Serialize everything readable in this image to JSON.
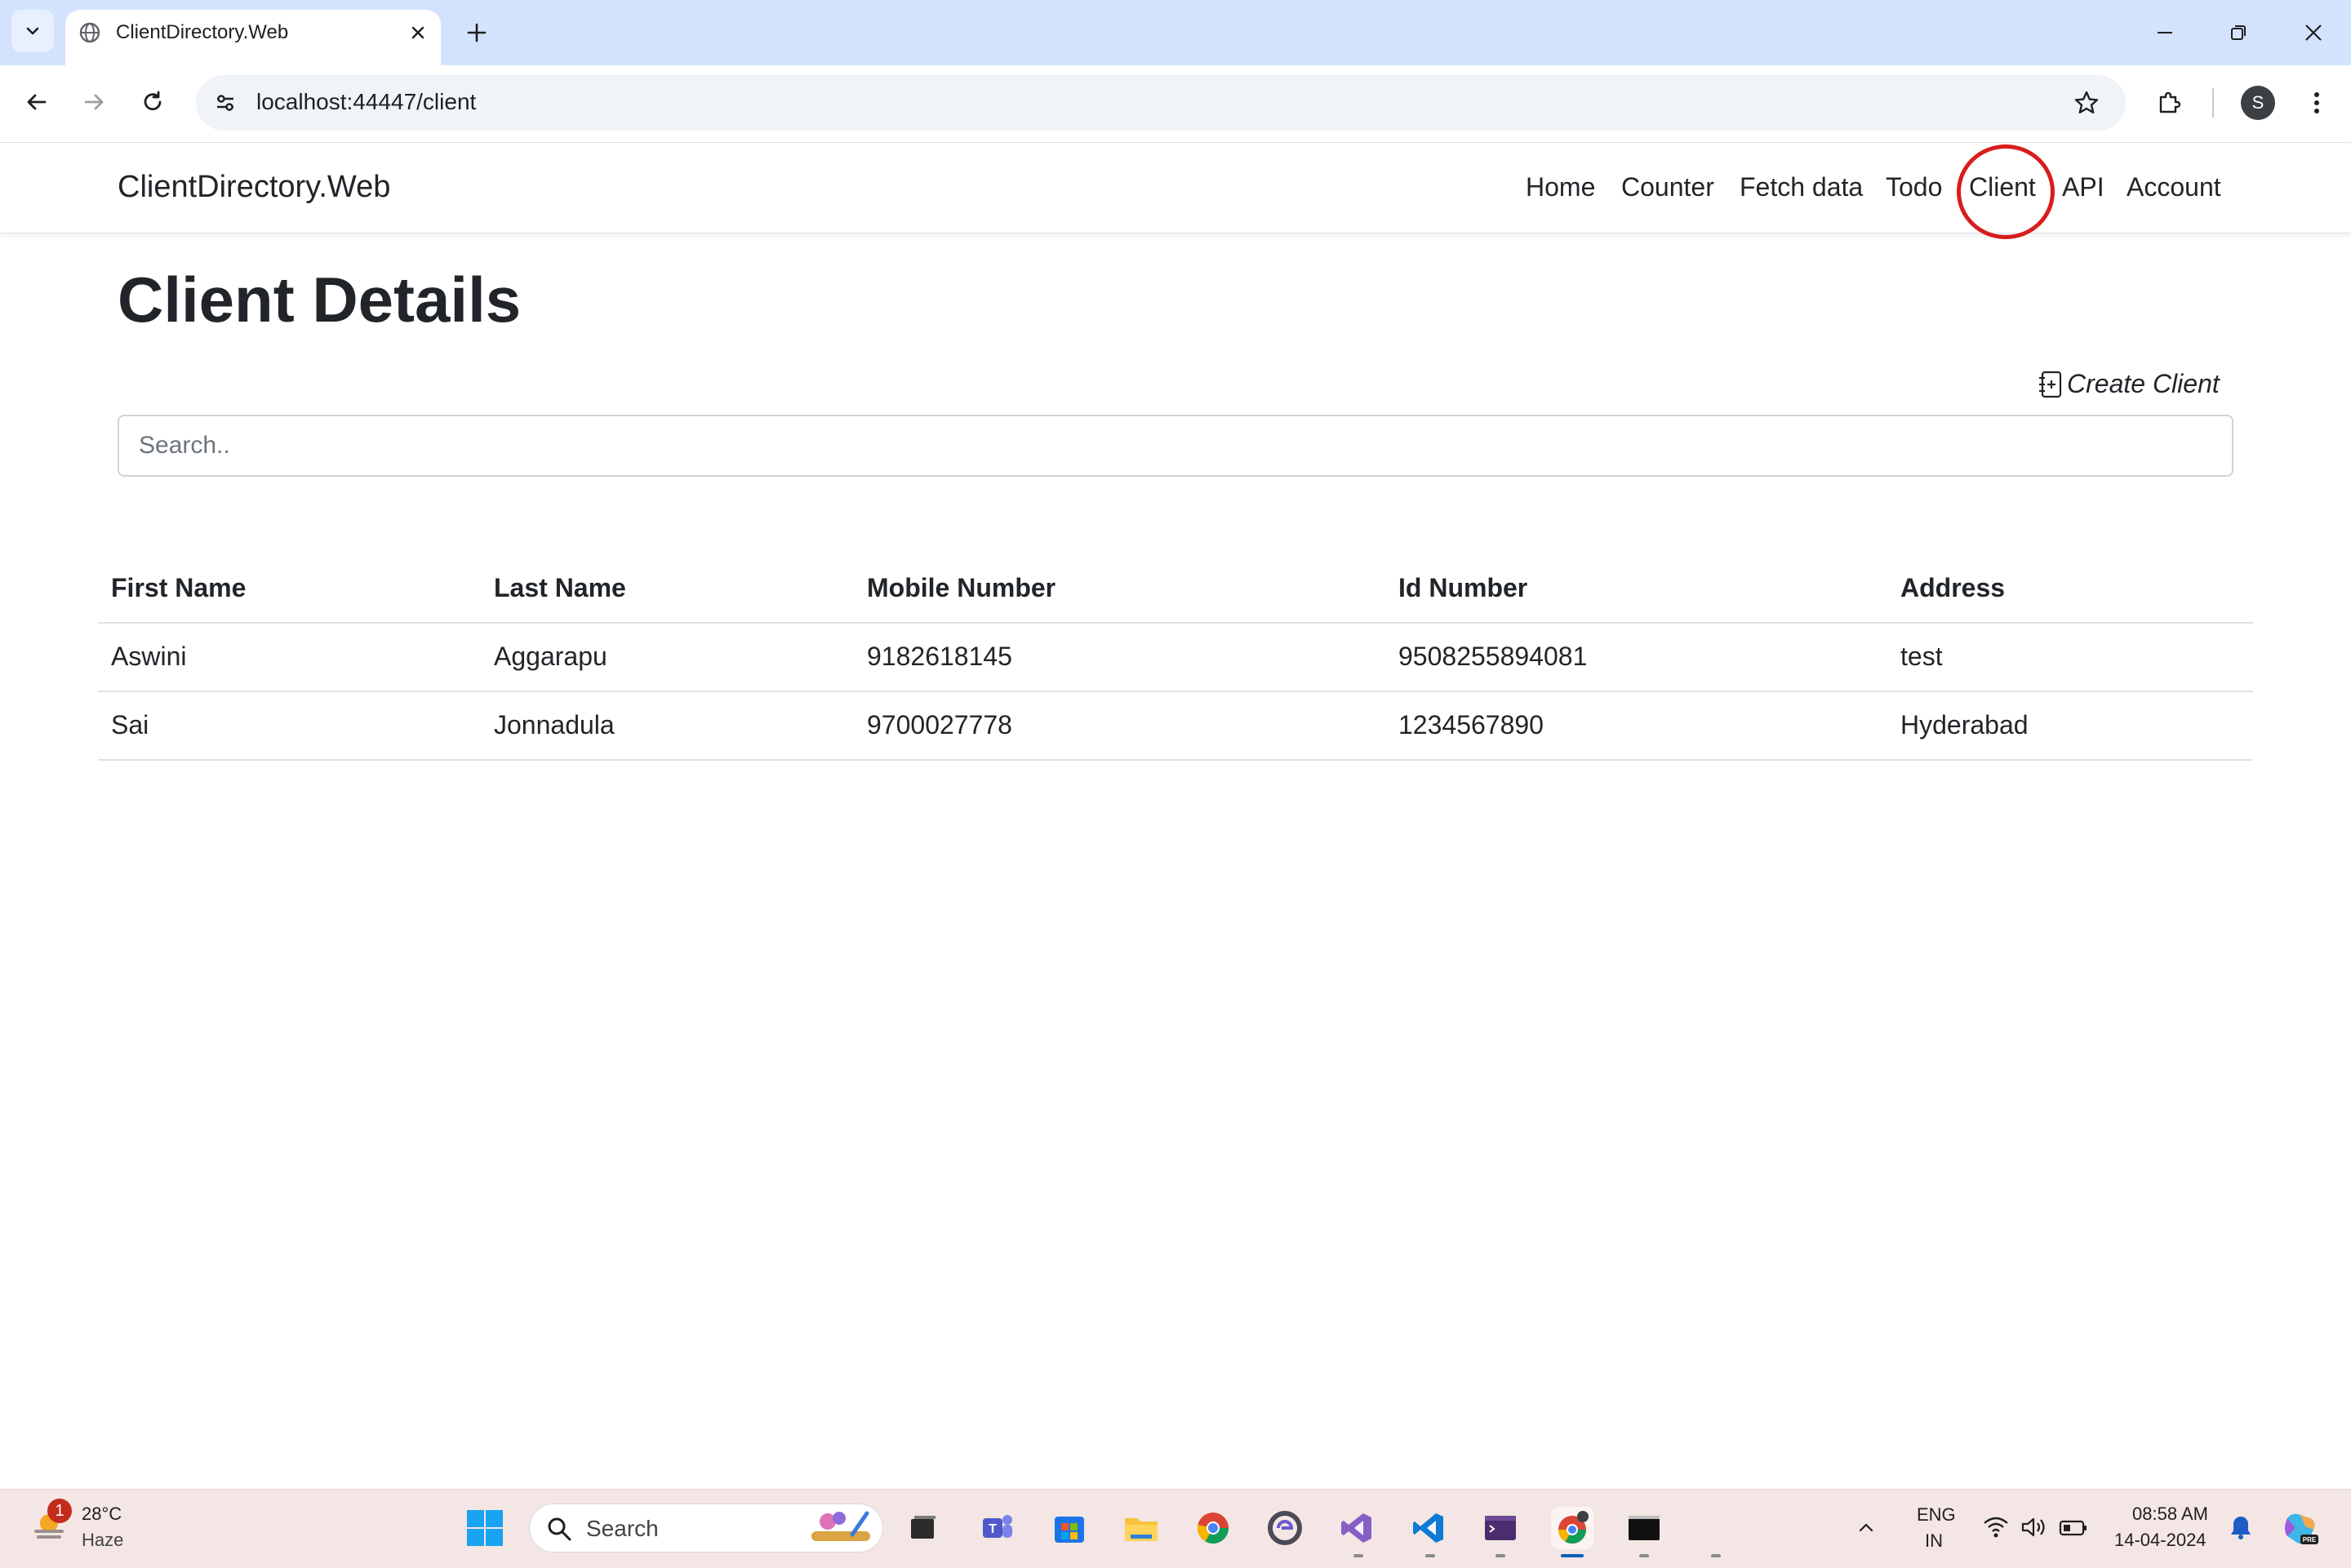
{
  "browser": {
    "tab_title": "ClientDirectory.Web",
    "url": "localhost:44447/client",
    "profile_initial": "S"
  },
  "app": {
    "brand": "ClientDirectory.Web",
    "nav": [
      "Home",
      "Counter",
      "Fetch data",
      "Todo",
      "Client",
      "API",
      "Account"
    ],
    "highlighted_nav": "Client",
    "highlight_color": "#d91c1c"
  },
  "page": {
    "title": "Client Details",
    "create_label": "Create Client",
    "search_placeholder": "Search.."
  },
  "table": {
    "columns": [
      "First Name",
      "Last Name",
      "Mobile Number",
      "Id Number",
      "Address"
    ],
    "rows": [
      [
        "Aswini",
        "Aggarapu",
        "9182618145",
        "9508255894081",
        "test"
      ],
      [
        "Sai",
        "Jonnadula",
        "9700027778",
        "1234567890",
        "Hyderabad"
      ]
    ]
  },
  "taskbar": {
    "weather_badge": "1",
    "temperature": "28°C",
    "condition": "Haze",
    "search_label": "Search",
    "language_top": "ENG",
    "language_bottom": "IN",
    "time": "08:58 AM",
    "date": "14-04-2024"
  }
}
